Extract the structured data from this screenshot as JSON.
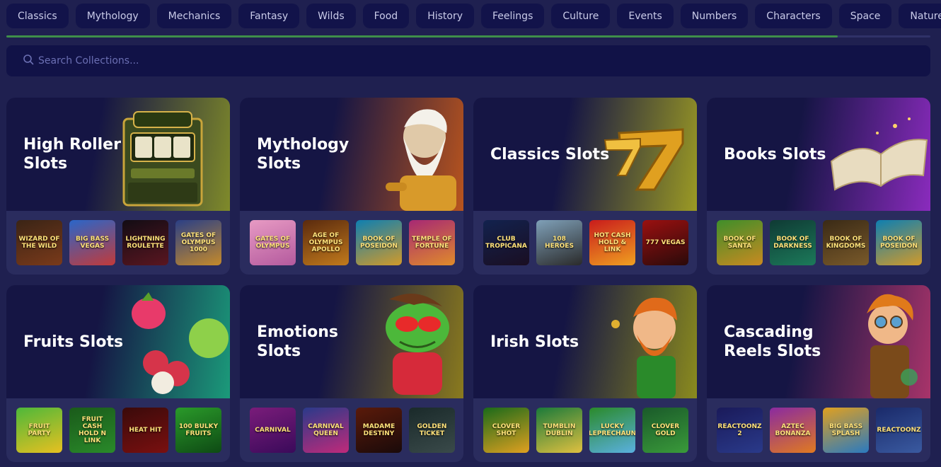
{
  "categories": [
    "Classics",
    "Mythology",
    "Mechanics",
    "Fantasy",
    "Wilds",
    "Food",
    "History",
    "Feelings",
    "Culture",
    "Events",
    "Numbers",
    "Characters",
    "Space",
    "Nature"
  ],
  "category_scroll_progress": 0.9,
  "search": {
    "placeholder": "Search Collections..."
  },
  "collections": [
    {
      "title": "High Roller Slots",
      "art": "slot-machine",
      "banner_colors": [
        "#151544",
        "#7f8a2a"
      ],
      "games": [
        {
          "title": "WIZARD OF THE WILD",
          "bg": [
            "#3a2416",
            "#7a3a1a"
          ]
        },
        {
          "title": "BIG BASS VEGAS",
          "bg": [
            "#2a66c9",
            "#c23a3a"
          ]
        },
        {
          "title": "LIGHTNING ROULETTE",
          "bg": [
            "#120c14",
            "#5a1620"
          ]
        },
        {
          "title": "GATES OF OLYMPUS 1000",
          "bg": [
            "#2a3f86",
            "#c58a2a"
          ]
        }
      ]
    },
    {
      "title": "Mythology Slots",
      "art": "zeus",
      "banner_colors": [
        "#151544",
        "#b8541e"
      ],
      "games": [
        {
          "title": "GATES OF OLYMPUS",
          "bg": [
            "#e79ac3",
            "#b45a9e"
          ]
        },
        {
          "title": "AGE OF OLYMPUS APOLLO",
          "bg": [
            "#5a2a0e",
            "#c27a1c"
          ]
        },
        {
          "title": "BOOK OF POSEIDON",
          "bg": [
            "#0e7fb1",
            "#d19a2a"
          ]
        },
        {
          "title": "TEMPLE OF FORTUNE",
          "bg": [
            "#a72874",
            "#e08b2a"
          ]
        }
      ]
    },
    {
      "title": "Classics Slots",
      "art": "seven",
      "banner_colors": [
        "#151544",
        "#9b9a24"
      ],
      "games": [
        {
          "title": "CLUB TROPICANA",
          "bg": [
            "#12224e",
            "#1a0e22"
          ]
        },
        {
          "title": "108 HEROES",
          "bg": [
            "#7fa0b8",
            "#2a2a2a"
          ]
        },
        {
          "title": "HOT CASH HOLD & LINK",
          "bg": [
            "#c91c1c",
            "#f0a020"
          ]
        },
        {
          "title": "777 VEGAS",
          "bg": [
            "#9a1010",
            "#2a0a0a"
          ]
        }
      ]
    },
    {
      "title": "Books Slots",
      "art": "book",
      "banner_colors": [
        "#151544",
        "#8a2bbd"
      ],
      "games": [
        {
          "title": "BOOK OF SANTA",
          "bg": [
            "#3f8e2a",
            "#c98a20"
          ]
        },
        {
          "title": "BOOK OF DARKNESS",
          "bg": [
            "#0f3a34",
            "#1c7a5a"
          ]
        },
        {
          "title": "BOOK OF KINGDOMS",
          "bg": [
            "#3a2a16",
            "#7a5a2a"
          ]
        },
        {
          "title": "BOOK OF POSEIDON",
          "bg": [
            "#0e7fb1",
            "#d19a2a"
          ]
        }
      ]
    },
    {
      "title": "Fruits Slots",
      "art": "fruits",
      "banner_colors": [
        "#151544",
        "#1b9a7a"
      ],
      "games": [
        {
          "title": "FRUIT PARTY",
          "bg": [
            "#4db83a",
            "#e8c020"
          ]
        },
        {
          "title": "FRUIT CASH HOLD N LINK",
          "bg": [
            "#1a5a1a",
            "#2a8a2a"
          ]
        },
        {
          "title": "HEAT HIT",
          "bg": [
            "#3a0a0a",
            "#7a1010"
          ]
        },
        {
          "title": "100 BULKY FRUITS",
          "bg": [
            "#2a9a2a",
            "#0e4a14"
          ]
        }
      ]
    },
    {
      "title": "Emotions Slots",
      "art": "frog",
      "banner_colors": [
        "#151544",
        "#8a7a1e"
      ],
      "games": [
        {
          "title": "CARNIVAL",
          "bg": [
            "#7a1c7a",
            "#3a0a5a"
          ]
        },
        {
          "title": "CARNIVAL QUEEN",
          "bg": [
            "#2a3a8a",
            "#c02a7a"
          ]
        },
        {
          "title": "MADAME DESTINY",
          "bg": [
            "#5a1a0a",
            "#1a0a0a"
          ]
        },
        {
          "title": "GOLDEN TICKET",
          "bg": [
            "#1a2a2a",
            "#3a4a4a"
          ]
        }
      ]
    },
    {
      "title": "Irish Slots",
      "art": "leprechaun",
      "banner_colors": [
        "#151544",
        "#8a8a1e"
      ],
      "games": [
        {
          "title": "CLOVER SHOT",
          "bg": [
            "#1a6a1a",
            "#e0a020"
          ]
        },
        {
          "title": "TUMBLIN DUBLIN",
          "bg": [
            "#1a7a3a",
            "#e0c040"
          ]
        },
        {
          "title": "LUCKY LEPRECHAUN",
          "bg": [
            "#2a8a2a",
            "#5ab0e0"
          ]
        },
        {
          "title": "CLOVER GOLD",
          "bg": [
            "#1a5a2a",
            "#3a9a3a"
          ]
        }
      ]
    },
    {
      "title": "Cascading Reels Slots",
      "art": "scientist",
      "banner_colors": [
        "#151544",
        "#a8346a"
      ],
      "games": [
        {
          "title": "REACTOONZ 2",
          "bg": [
            "#1a1a5a",
            "#2a3a8a"
          ]
        },
        {
          "title": "AZTEC BONANZA",
          "bg": [
            "#8a2aa0",
            "#e07a20"
          ]
        },
        {
          "title": "BIG BASS SPLASH",
          "bg": [
            "#e0a020",
            "#2a7ac0"
          ]
        },
        {
          "title": "REACTOONZ",
          "bg": [
            "#1a2a6a",
            "#3a5aa0"
          ]
        }
      ]
    }
  ]
}
